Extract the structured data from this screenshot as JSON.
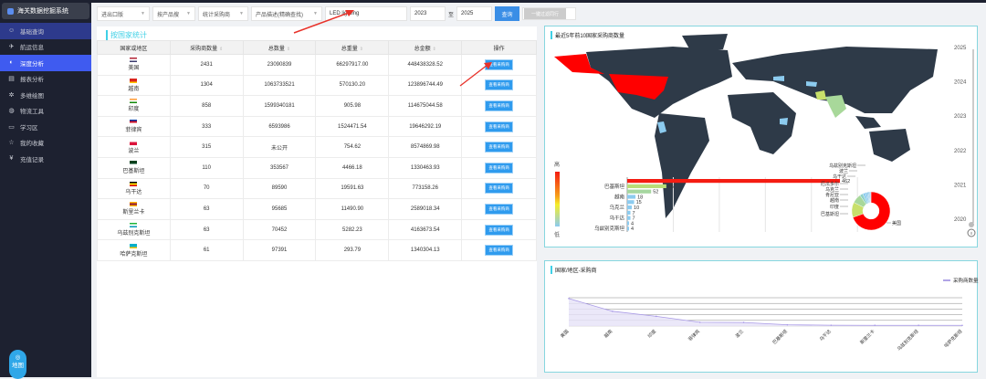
{
  "app": {
    "title": "海关数据挖掘系统"
  },
  "sidebar": {
    "items": [
      {
        "label": "基础查询",
        "icon": "search-user-icon"
      },
      {
        "label": "航运信息",
        "icon": "plane-icon"
      },
      {
        "label": "深度分析",
        "icon": "analysis-icon"
      },
      {
        "label": "报表分析",
        "icon": "chart-icon"
      },
      {
        "label": "多维绘图",
        "icon": "gear-icon"
      },
      {
        "label": "物流工具",
        "icon": "globe-icon"
      },
      {
        "label": "学习区",
        "icon": "book-icon"
      },
      {
        "label": "我的收藏",
        "icon": "star-icon"
      },
      {
        "label": "充值记录",
        "icon": "money-icon"
      }
    ],
    "map_button": "地图"
  },
  "filters": {
    "trade_type": "进出口版",
    "search_by": "按产品搜",
    "stat_type": "统计采购商",
    "desc_type": "产品描述(精确查找)",
    "keyword": "LED lighting",
    "year_from": "2023",
    "to_label": "至",
    "year_to": "2025",
    "query_label": "查询",
    "export_label": "一键过滤同行"
  },
  "table": {
    "title": "按国家统计",
    "headers": [
      "国家或地区",
      "采购商数量",
      "总数量",
      "总重量",
      "总金额",
      "操作"
    ],
    "rows": [
      {
        "country": "美国",
        "buyers": "2431",
        "qty": "23090839",
        "weight": "66297917.00",
        "amount": "448438328.52",
        "flag": [
          "#b22234",
          "#fff",
          "#3c3b6e"
        ]
      },
      {
        "country": "越南",
        "buyers": "1304",
        "qty": "1063733521",
        "weight": "570130.20",
        "amount": "123896744.49",
        "flag": [
          "#da251d",
          "#da251d",
          "#ffcd00"
        ]
      },
      {
        "country": "印度",
        "buyers": "858",
        "qty": "1599340181",
        "weight": "905.98",
        "amount": "114675044.58",
        "flag": [
          "#ff9933",
          "#fff",
          "#138808"
        ]
      },
      {
        "country": "菲律宾",
        "buyers": "333",
        "qty": "6593986",
        "weight": "1524471.54",
        "amount": "19646292.19",
        "flag": [
          "#0038a8",
          "#ce1126",
          "#fff"
        ]
      },
      {
        "country": "波兰",
        "buyers": "315",
        "qty": "未公开",
        "weight": "754.62",
        "amount": "8574869.98",
        "flag": [
          "#fff",
          "#dc143c",
          "#dc143c"
        ]
      },
      {
        "country": "巴基斯坦",
        "buyers": "110",
        "qty": "353567",
        "weight": "4466.18",
        "amount": "1330463.93",
        "flag": [
          "#01411c",
          "#01411c",
          "#fff"
        ]
      },
      {
        "country": "乌干达",
        "buyers": "70",
        "qty": "89590",
        "weight": "19591.63",
        "amount": "773158.26",
        "flag": [
          "#000",
          "#fcdc04",
          "#d90000"
        ]
      },
      {
        "country": "斯里兰卡",
        "buyers": "63",
        "qty": "95685",
        "weight": "11490.90",
        "amount": "2589018.34",
        "flag": [
          "#ffb700",
          "#8d153a",
          "#ffb700"
        ]
      },
      {
        "country": "乌兹别克斯坦",
        "buyers": "63",
        "qty": "70452",
        "weight": "5282.23",
        "amount": "4163673.54",
        "flag": [
          "#1eb53a",
          "#fff",
          "#0099b5"
        ]
      },
      {
        "country": "哈萨克斯坦",
        "buyers": "61",
        "qty": "97391",
        "weight": "293.79",
        "amount": "1340304.13",
        "flag": [
          "#00afca",
          "#00afca",
          "#fec50c"
        ]
      }
    ],
    "action_label": "查看采购商"
  },
  "map_panel": {
    "title": "最近5年前10国家采购商数量",
    "timeline": [
      "2025",
      "2024",
      "2023",
      "2022",
      "2021",
      "2020"
    ],
    "legend_high": "高",
    "legend_low": "低",
    "colors": {
      "usa": "#ff0000",
      "land": "#2e3a48",
      "low": "#8ccbef",
      "mid": "#a8d89a",
      "high": "#c8e06a"
    }
  },
  "chart_data": [
    {
      "type": "bar",
      "title": "",
      "categories": [
        "美国",
        "巴基斯坦",
        "印度",
        "越南",
        "肯尼亚",
        "乌克兰",
        "厄瓜多尔",
        "乌干达",
        "波兰",
        "乌兹别克斯坦"
      ],
      "visible_labels": [
        "巴基斯坦",
        "越南",
        "乌克兰",
        "乌干达",
        "乌兹别克斯坦"
      ],
      "values": [
        462,
        85,
        52,
        18,
        15,
        10,
        7,
        7,
        4,
        4
      ],
      "colors": [
        "#f41c12",
        "#b9dd78",
        "#a6d6a0",
        "#8ccbef",
        "#8ccbef",
        "#8ccbef",
        "#8ccbef",
        "#8ccbef",
        "#8ccbef",
        "#8ccbef"
      ]
    },
    {
      "type": "pie",
      "categories": [
        "美国",
        "巴基斯坦",
        "印度",
        "越南",
        "肯尼亚",
        "乌克兰",
        "厄瓜多尔",
        "乌干达",
        "波兰",
        "乌兹别克斯坦"
      ],
      "values": [
        462,
        85,
        52,
        18,
        15,
        10,
        7,
        7,
        4,
        4
      ],
      "colors": [
        "#ff0000",
        "#c8e06a",
        "#a8d89a",
        "#8fd0c8",
        "#8ccbef",
        "#7fc4e8",
        "#7bbfe5",
        "#76bbe3",
        "#72b6e0",
        "#6db1de"
      ]
    },
    {
      "type": "area",
      "title": "国家/地区-采购商",
      "legend": [
        "采购商数量"
      ],
      "categories": [
        "美国",
        "越南",
        "印度",
        "菲律宾",
        "波兰",
        "巴基斯坦",
        "乌干达",
        "斯里兰卡",
        "乌兹别克斯坦",
        "哈萨克斯坦"
      ],
      "values": [
        2431,
        1304,
        858,
        333,
        315,
        110,
        70,
        63,
        63,
        61
      ],
      "ylim": [
        0,
        2500
      ]
    }
  ]
}
